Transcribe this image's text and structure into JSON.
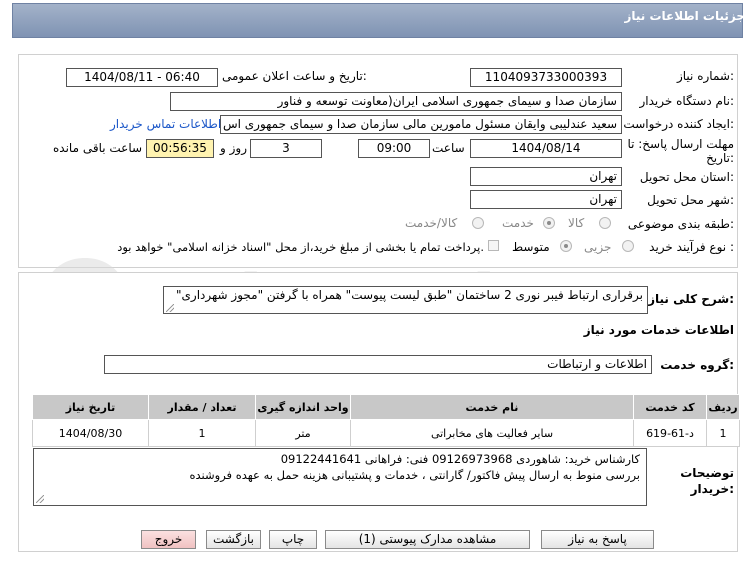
{
  "header": {
    "title": "جزئیات اطلاعات نیاز"
  },
  "fields": {
    "need_number_label": "شماره نیاز:",
    "need_number": "1104093733000393",
    "announce_label": "تاریخ و ساعت اعلان عمومی:",
    "announce_value": "1404/08/11 - 06:40",
    "buyer_org_label": "نام دستگاه خریدار:",
    "buyer_org": "سازمان صدا و سیمای جمهوری اسلامی ایران(معاونت توسعه و فناور",
    "creator_label": "ایجاد کننده درخواست:",
    "creator": "سعید عندلیبی وایقان مسئول مامورین مالی  سازمان صدا و سیمای جمهوری اس",
    "contact_link": "اطلاعات تماس خریدار",
    "deadline_label_1": "مهلت ارسال پاسخ: تا",
    "deadline_label_2": "تاریخ:",
    "deadline_date": "1404/08/14",
    "time_label": "ساعت",
    "deadline_time": "09:00",
    "days": "3",
    "days_label": "روز و",
    "remaining_time": "00:56:35",
    "remaining_label": "ساعت باقی مانده",
    "province_label": "استان محل تحویل:",
    "province": "تهران",
    "city_label": "شهر محل تحویل:",
    "city": "تهران",
    "category_label": "طبقه بندی موضوعی:",
    "category_options": [
      "کالا",
      "خدمت",
      "کالا/خدمت"
    ],
    "process_label": "نوع فرآیند خرید :",
    "process_options": [
      "جزیی",
      "متوسط"
    ],
    "treasury_note": "پرداخت تمام یا بخشی از مبلغ خرید،از محل \"اسناد خزانه اسلامی\" خواهد بود."
  },
  "general": {
    "desc_label": "شرح کلی نیاز:",
    "description": "برقراری ارتباط فیبر نوری 2 ساختمان \"طبق لیست پیوست\" همراه با گرفتن \"مجوز شهرداری\"",
    "services_title": "اطلاعات خدمات مورد نیاز",
    "service_group_label": "گروه خدمت:",
    "service_group": "اطلاعات و ارتباطات"
  },
  "table": {
    "headers": [
      "ردیف",
      "کد خدمت",
      "نام خدمت",
      "واحد اندازه گیری",
      "تعداد / مقدار",
      "تاریخ نیاز"
    ],
    "rows": [
      [
        "1",
        "د-61-619",
        "سایر فعالیت های مخابراتی",
        "متر",
        "1",
        "1404/08/30"
      ]
    ]
  },
  "notes": {
    "label_1": "توضیحات",
    "label_2": "خریدار:",
    "line_1": "کارشناس خرید: شاهوردی 09126973968  فنی: فراهانی 09122441641",
    "line_2": "بررسی منوط به ارسال پیش فاکتور/ گارانتی ، خدمات و پشتیبانی هزینه حمل به عهده فروشنده"
  },
  "buttons": {
    "reply": "پاسخ به نیاز",
    "attachments": "مشاهده مدارک پیوستی (1)",
    "print": "چاپ",
    "back": "بازگشت",
    "exit": "خروج"
  },
  "watermark": {
    "text": "AriaTender.net"
  },
  "colors": {
    "header": "#8a9cba",
    "link": "#1a56c8",
    "remaining_bg": "#fff3b0",
    "exit_button": "#f0c2c2"
  }
}
